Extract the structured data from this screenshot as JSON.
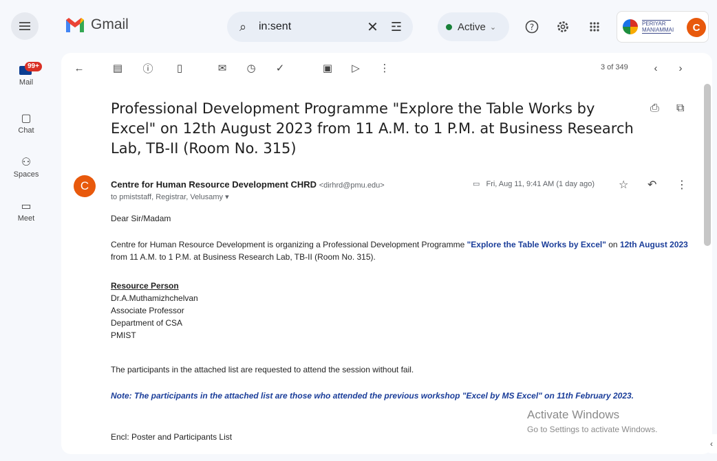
{
  "app": {
    "name": "Gmail"
  },
  "search": {
    "query": "in:sent"
  },
  "status": {
    "label": "Active"
  },
  "org": {
    "name_line1": "PERIYAR",
    "name_line2": "MANIAMMAI"
  },
  "account": {
    "initial": "C"
  },
  "rail": {
    "mail_badge": "99+",
    "mail_label": "Mail",
    "chat_label": "Chat",
    "spaces_label": "Spaces",
    "meet_label": "Meet"
  },
  "toolbar": {
    "count": "3 of 349"
  },
  "email": {
    "subject": "Professional Development Programme \"Explore the Table Works by Excel\" on 12th August 2023 from 11 A.M. to 1 P.M. at Business Research Lab, TB-II (Room No. 315)",
    "sender_initial": "C",
    "sender_name": "Centre for Human Resource Development CHRD",
    "sender_email": "<dirhrd@pmu.edu>",
    "to_line": "to pmiststaff, Registrar, Velusamy",
    "date": "Fri, Aug 11, 9:41 AM (1 day ago)",
    "greeting": "Dear Sir/Madam",
    "intro_1": "Centre for Human Resource Development is organizing a Professional Development Programme ",
    "intro_hl_1": "\"Explore the Table Works by Excel\"",
    "intro_2": " on ",
    "intro_hl_2": "12th August 2023",
    "intro_3": " from 11 A.M. to 1 P.M. at Business Research Lab, TB-II (Room No. 315).",
    "rp_title": "Resource Person",
    "rp_name": "Dr.A.Muthamizhchelvan",
    "rp_designation": "Associate Professor",
    "rp_department": "Department of CSA",
    "rp_institution": "PMIST",
    "request": "The participants in the attached list are requested to attend the session without fail.",
    "note": "Note: The participants in the attached list are those who attended the previous workshop \"Excel by MS Excel\" on 11th February 2023.",
    "enclosure": "Encl: Poster and Participants List"
  },
  "watermark": {
    "line1": "Activate Windows",
    "line2": "Go to Settings to activate Windows."
  },
  "colors": {
    "accent": "#1a3d99",
    "avatar": "#e8590c",
    "badge": "#d93025",
    "active": "#188038"
  }
}
